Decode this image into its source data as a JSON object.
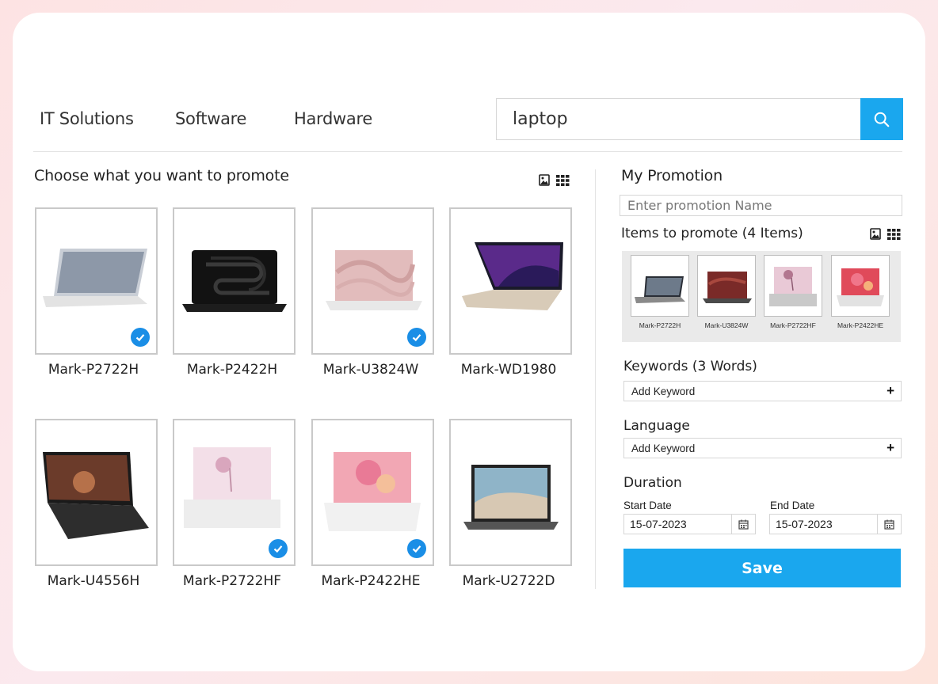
{
  "nav": {
    "links": [
      "IT Solutions",
      "Software",
      "Hardware"
    ]
  },
  "search": {
    "value": "laptop",
    "icon": "search-icon"
  },
  "left": {
    "title": "Choose what you want to promote",
    "products": [
      {
        "label": "Mark-P2722H",
        "selected": true
      },
      {
        "label": "Mark-P2422H",
        "selected": false
      },
      {
        "label": "Mark-U3824W",
        "selected": true
      },
      {
        "label": "Mark-WD1980",
        "selected": false
      },
      {
        "label": "Mark-U4556H",
        "selected": false
      },
      {
        "label": "Mark-P2722HF",
        "selected": true
      },
      {
        "label": "Mark-P2422HE",
        "selected": true
      },
      {
        "label": "Mark-U2722D",
        "selected": false
      }
    ]
  },
  "right": {
    "title": "My Promotion",
    "promo_placeholder": "Enter promotion Name",
    "items_title": "Items to promote (4 Items)",
    "items": [
      "Mark-P2722H",
      "Mark-U3824W",
      "Mark-P2722HF",
      "Mark-P2422HE"
    ],
    "keywords_title": "Keywords (3 Words)",
    "keyword_placeholder": "Add Keyword",
    "language_title": "Language",
    "language_placeholder": "Add Keyword",
    "duration_title": "Duration",
    "start_label": "Start Date",
    "start_value": "15-07-2023",
    "end_label": "End Date",
    "end_value": "15-07-2023",
    "save_label": "Save"
  },
  "colors": {
    "accent": "#1aa7ee",
    "check": "#1a8ee6"
  }
}
